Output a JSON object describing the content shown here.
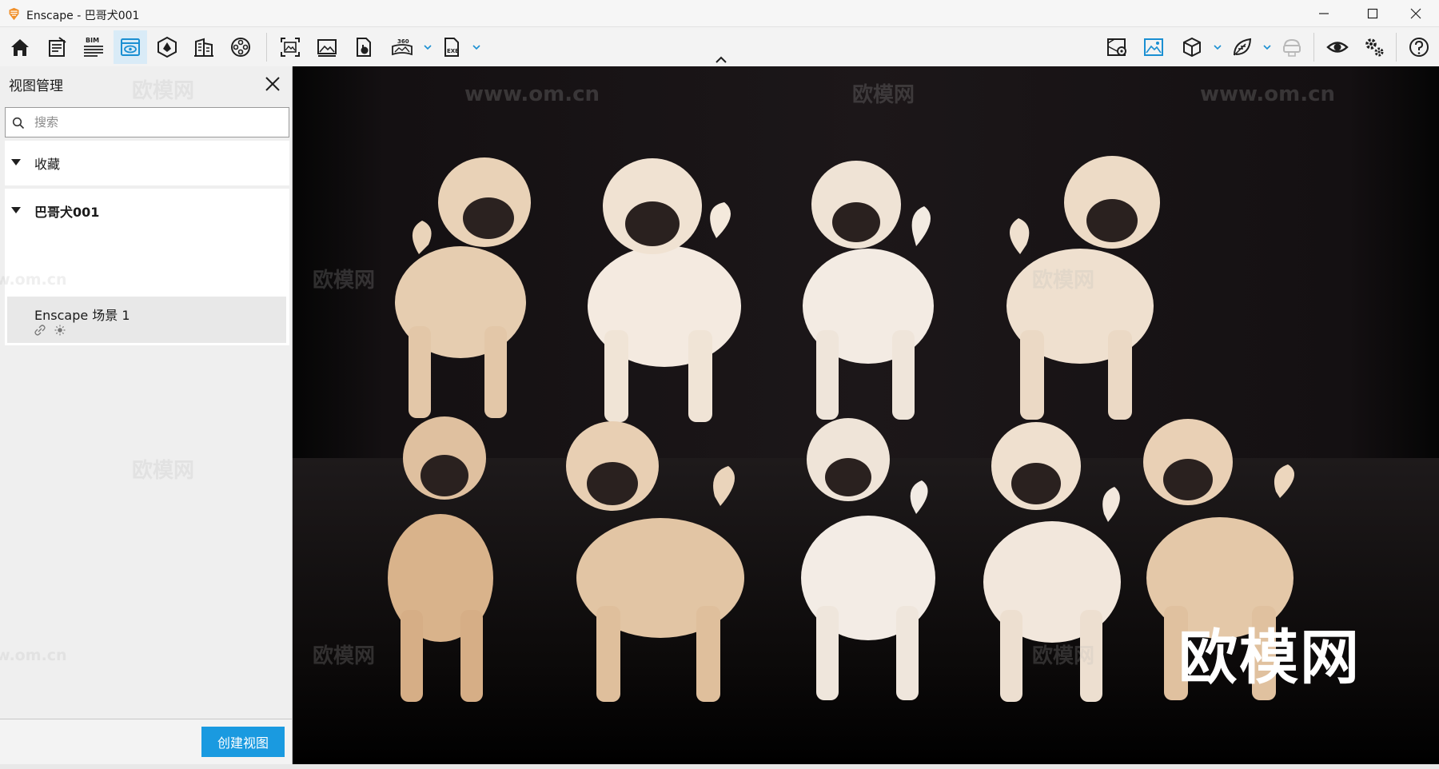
{
  "window": {
    "title": "Enscape - 巴哥犬001",
    "controls": [
      "minimize-icon",
      "maximize-icon",
      "close-icon"
    ]
  },
  "toolbar": {
    "left_tools": [
      "home-icon",
      "notes-icon",
      "bim-icon",
      "view-management-icon",
      "sun-position-icon",
      "building-icon",
      "video-reel-icon",
      "screenshot-icon",
      "image-icon",
      "export-doc-icon",
      "panorama-360-icon",
      "exe-export-icon"
    ],
    "bim_label": "BIM",
    "pano_label": "360",
    "exe_label": "EXE",
    "right_tools": [
      "map-pin-icon",
      "material-image-icon",
      "cube-icon",
      "leaf-icon",
      "vr-headset-icon",
      "eye-icon",
      "settings-icon",
      "help-icon"
    ],
    "active_tool": "view-management-icon"
  },
  "sidebar": {
    "title": "视图管理",
    "search_placeholder": "搜索",
    "groups": [
      {
        "label": "收藏",
        "expanded": true
      },
      {
        "label": "巴哥犬001",
        "expanded": true
      }
    ],
    "views": [
      {
        "name": "Enscape 场景 1"
      }
    ],
    "create_button": "创建视图"
  },
  "viewport": {
    "logo_text": "欧模网",
    "watermark_text": "欧模网",
    "watermark_url": "www.om.cn",
    "colors": {
      "accent": "#1a9ae0",
      "background": "#1a1617"
    }
  }
}
